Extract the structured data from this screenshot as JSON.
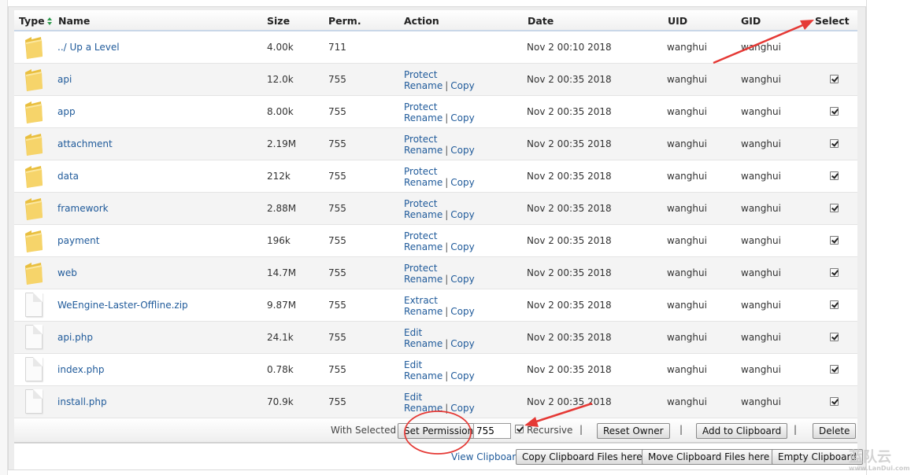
{
  "columns": {
    "type": "Type",
    "name": "Name",
    "size": "Size",
    "perm": "Perm.",
    "action": "Action",
    "date": "Date",
    "uid": "UID",
    "gid": "GID",
    "select": "Select"
  },
  "rows": [
    {
      "kind": "folder",
      "name": "../ Up a Level",
      "size": "4.00k",
      "perm": "711",
      "actions": [],
      "date": "Nov 2 00:10 2018",
      "uid": "wanghui",
      "gid": "wanghui",
      "selected": false
    },
    {
      "kind": "folder",
      "name": "api",
      "size": "12.0k",
      "perm": "755",
      "actions": [
        "Protect",
        "Rename",
        "Copy"
      ],
      "date": "Nov 2 00:35 2018",
      "uid": "wanghui",
      "gid": "wanghui",
      "selected": true
    },
    {
      "kind": "folder",
      "name": "app",
      "size": "8.00k",
      "perm": "755",
      "actions": [
        "Protect",
        "Rename",
        "Copy"
      ],
      "date": "Nov 2 00:35 2018",
      "uid": "wanghui",
      "gid": "wanghui",
      "selected": true
    },
    {
      "kind": "folder",
      "name": "attachment",
      "size": "2.19M",
      "perm": "755",
      "actions": [
        "Protect",
        "Rename",
        "Copy"
      ],
      "date": "Nov 2 00:35 2018",
      "uid": "wanghui",
      "gid": "wanghui",
      "selected": true
    },
    {
      "kind": "folder",
      "name": "data",
      "size": "212k",
      "perm": "755",
      "actions": [
        "Protect",
        "Rename",
        "Copy"
      ],
      "date": "Nov 2 00:35 2018",
      "uid": "wanghui",
      "gid": "wanghui",
      "selected": true
    },
    {
      "kind": "folder",
      "name": "framework",
      "size": "2.88M",
      "perm": "755",
      "actions": [
        "Protect",
        "Rename",
        "Copy"
      ],
      "date": "Nov 2 00:35 2018",
      "uid": "wanghui",
      "gid": "wanghui",
      "selected": true
    },
    {
      "kind": "folder",
      "name": "payment",
      "size": "196k",
      "perm": "755",
      "actions": [
        "Protect",
        "Rename",
        "Copy"
      ],
      "date": "Nov 2 00:35 2018",
      "uid": "wanghui",
      "gid": "wanghui",
      "selected": true
    },
    {
      "kind": "folder",
      "name": "web",
      "size": "14.7M",
      "perm": "755",
      "actions": [
        "Protect",
        "Rename",
        "Copy"
      ],
      "date": "Nov 2 00:35 2018",
      "uid": "wanghui",
      "gid": "wanghui",
      "selected": true
    },
    {
      "kind": "file",
      "name": "WeEngine-Laster-Offline.zip",
      "size": "9.87M",
      "perm": "755",
      "actions": [
        "Extract",
        "Rename",
        "Copy"
      ],
      "date": "Nov 2 00:35 2018",
      "uid": "wanghui",
      "gid": "wanghui",
      "selected": true
    },
    {
      "kind": "file",
      "name": "api.php",
      "size": "24.1k",
      "perm": "755",
      "actions": [
        "Edit",
        "Rename",
        "Copy"
      ],
      "date": "Nov 2 00:35 2018",
      "uid": "wanghui",
      "gid": "wanghui",
      "selected": true
    },
    {
      "kind": "file",
      "name": "index.php",
      "size": "0.78k",
      "perm": "755",
      "actions": [
        "Edit",
        "Rename",
        "Copy"
      ],
      "date": "Nov 2 00:35 2018",
      "uid": "wanghui",
      "gid": "wanghui",
      "selected": true
    },
    {
      "kind": "file",
      "name": "install.php",
      "size": "70.9k",
      "perm": "755",
      "actions": [
        "Edit",
        "Rename",
        "Copy"
      ],
      "date": "Nov 2 00:35 2018",
      "uid": "wanghui",
      "gid": "wanghui",
      "selected": true
    }
  ],
  "bulk": {
    "with_selected": "With Selected",
    "set_permission": "Set Permission",
    "perm_value": "755",
    "recursive": "Recursive",
    "recursive_checked": true,
    "sep": "|",
    "reset_owner": "Reset Owner",
    "add_to_clipboard": "Add to Clipboard",
    "delete": "Delete"
  },
  "clipboard": {
    "view": "View Clipboard",
    "copy_here": "Copy Clipboard Files here",
    "move_here": "Move Clipboard Files here",
    "empty": "Empty Clipboard"
  },
  "watermark": {
    "text": "蓝队云",
    "sub": "www.LanDui.com"
  },
  "colors": {
    "link": "#1f5a9a",
    "annotation": "#e53935"
  }
}
